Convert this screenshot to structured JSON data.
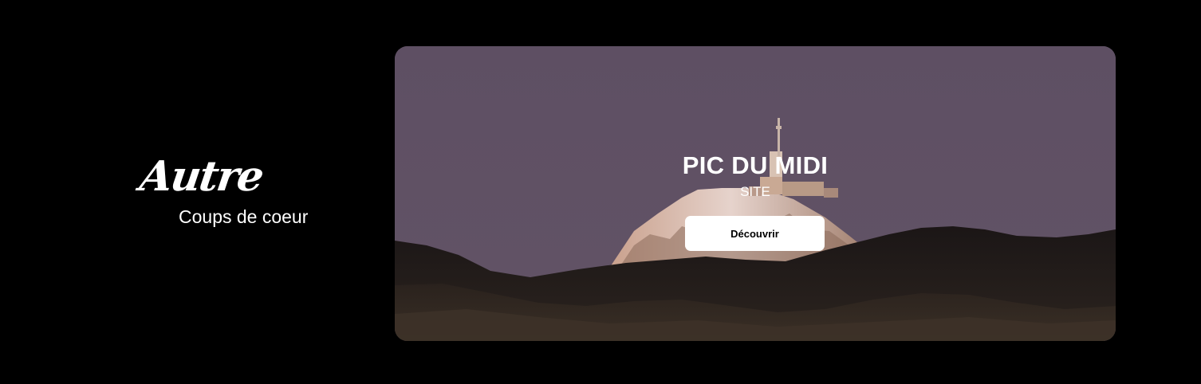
{
  "section": {
    "script_title": "Autre",
    "subtitle": "Coups de coeur"
  },
  "card": {
    "title": "PIC DU MIDI",
    "category": "SITE",
    "button_label": "Découvrir",
    "image": "mountain-observatory-landscape"
  },
  "colors": {
    "page_background": "#000000",
    "sky": "#5f5064",
    "button_background": "#ffffff",
    "button_text": "#000000",
    "text": "#ffffff"
  }
}
